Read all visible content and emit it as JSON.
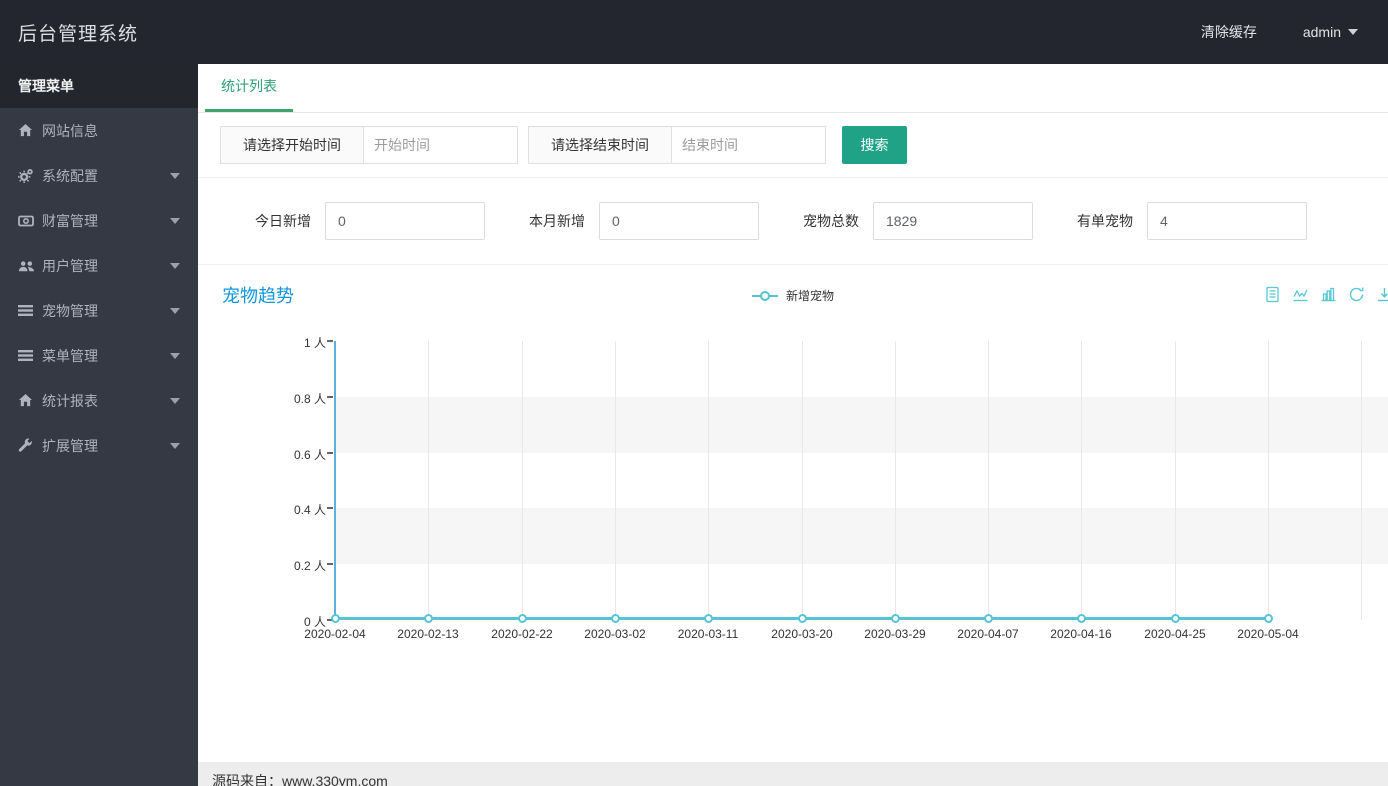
{
  "header": {
    "title": "后台管理系统",
    "clear_cache": "清除缓存",
    "user": "admin"
  },
  "sidebar": {
    "menu_title": "管理菜单",
    "items": [
      {
        "label": "网站信息",
        "icon": "home",
        "has_children": false
      },
      {
        "label": "系统配置",
        "icon": "gears",
        "has_children": true
      },
      {
        "label": "财富管理",
        "icon": "money",
        "has_children": true
      },
      {
        "label": "用户管理",
        "icon": "users",
        "has_children": true
      },
      {
        "label": "宠物管理",
        "icon": "list",
        "has_children": true
      },
      {
        "label": "菜单管理",
        "icon": "list",
        "has_children": true
      },
      {
        "label": "统计报表",
        "icon": "home",
        "has_children": true
      },
      {
        "label": "扩展管理",
        "icon": "wrench",
        "has_children": true
      }
    ]
  },
  "tabs": {
    "active": "统计列表"
  },
  "filters": {
    "start_label": "请选择开始时间",
    "start_placeholder": "开始时间",
    "end_label": "请选择结束时间",
    "end_placeholder": "结束时间",
    "search_label": "搜索"
  },
  "stats": [
    {
      "label": "今日新增",
      "value": "0"
    },
    {
      "label": "本月新增",
      "value": "0"
    },
    {
      "label": "宠物总数",
      "value": "1829"
    },
    {
      "label": "有单宠物",
      "value": "4"
    }
  ],
  "chart": {
    "title": "宠物趋势",
    "legend": "新增宠物",
    "toolbox": [
      "data-view",
      "line-chart",
      "bar-chart",
      "restore",
      "download"
    ]
  },
  "chart_data": {
    "type": "line",
    "title": "宠物趋势",
    "x": [
      "2020-02-04",
      "2020-02-13",
      "2020-02-22",
      "2020-03-02",
      "2020-03-11",
      "2020-03-20",
      "2020-03-29",
      "2020-04-07",
      "2020-04-16",
      "2020-04-25",
      "2020-05-04"
    ],
    "series": [
      {
        "name": "新增宠物",
        "values": [
          0,
          0,
          0,
          0,
          0,
          0,
          0,
          0,
          0,
          0,
          0
        ]
      }
    ],
    "y_ticks": [
      "1 人",
      "0.8 人",
      "0.6 人",
      "0.4 人",
      "0.2 人",
      "0 人"
    ],
    "ylim": [
      0,
      1
    ],
    "unit": "人",
    "grid": true,
    "legend_position": "top-center"
  },
  "footer": {
    "text": "源码来自：www.330ym.com"
  },
  "colors": {
    "topbar_bg": "#23262e",
    "sidebar_bg": "#343944",
    "menu_title_bg": "#23262c",
    "accent_green": "#20a287",
    "tab_green": "#2e9e75",
    "tab_underline": "#3fa46e",
    "chart_title_blue": "#1296db",
    "series_cyan": "#55c5d4",
    "yaxis_blue": "#5fb0e2",
    "band_gray": "#f6f6f6",
    "grid_line": "#e8e8e8"
  }
}
